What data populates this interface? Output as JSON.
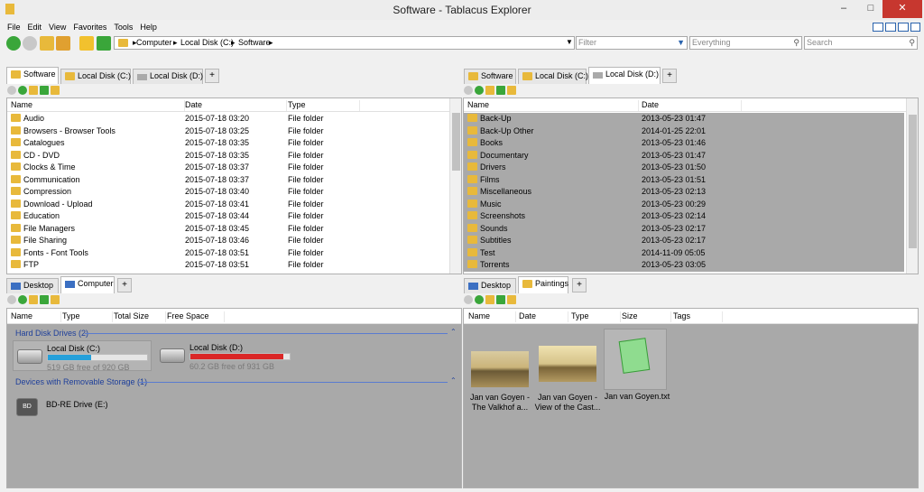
{
  "window": {
    "title": "Software - Tablacus Explorer",
    "min": "–",
    "max": "□",
    "close": "✕"
  },
  "menu": [
    "File",
    "Edit",
    "View",
    "Favorites",
    "Tools",
    "Help"
  ],
  "address": {
    "parts": [
      "Computer",
      "Local Disk (C:)",
      "Software"
    ]
  },
  "filter_placeholder": "Filter",
  "everything_placeholder": "Everything",
  "search_placeholder": "Search",
  "top_left": {
    "tabs": [
      "Software",
      "Local Disk (C:)",
      "Local Disk (D:)"
    ],
    "columns": [
      "Name",
      "Date",
      "Type"
    ],
    "rows": [
      [
        "Audio",
        "2015-07-18 03:20",
        "File folder"
      ],
      [
        "Browsers - Browser Tools",
        "2015-07-18 03:25",
        "File folder"
      ],
      [
        "Catalogues",
        "2015-07-18 03:35",
        "File folder"
      ],
      [
        "CD - DVD",
        "2015-07-18 03:35",
        "File folder"
      ],
      [
        "Clocks & Time",
        "2015-07-18 03:37",
        "File folder"
      ],
      [
        "Communication",
        "2015-07-18 03:37",
        "File folder"
      ],
      [
        "Compression",
        "2015-07-18 03:40",
        "File folder"
      ],
      [
        "Download - Upload",
        "2015-07-18 03:41",
        "File folder"
      ],
      [
        "Education",
        "2015-07-18 03:44",
        "File folder"
      ],
      [
        "File Managers",
        "2015-07-18 03:45",
        "File folder"
      ],
      [
        "File Sharing",
        "2015-07-18 03:46",
        "File folder"
      ],
      [
        "Fonts - Font Tools",
        "2015-07-18 03:51",
        "File folder"
      ],
      [
        "FTP",
        "2015-07-18 03:51",
        "File folder"
      ]
    ]
  },
  "top_right": {
    "tabs": [
      "Software",
      "Local Disk (C:)",
      "Local Disk (D:)"
    ],
    "columns": [
      "Name",
      "Date"
    ],
    "rows": [
      [
        "Back-Up",
        "2013-05-23 01:47"
      ],
      [
        "Back-Up Other",
        "2014-01-25 22:01"
      ],
      [
        "Books",
        "2013-05-23 01:46"
      ],
      [
        "Documentary",
        "2013-05-23 01:47"
      ],
      [
        "Drivers",
        "2013-05-23 01:50"
      ],
      [
        "Films",
        "2013-05-23 01:51"
      ],
      [
        "Miscellaneous",
        "2013-05-23 02:13"
      ],
      [
        "Music",
        "2013-05-23 00:29"
      ],
      [
        "Screenshots",
        "2013-05-23 02:14"
      ],
      [
        "Sounds",
        "2013-05-23 02:17"
      ],
      [
        "Subtitles",
        "2013-05-23 02:17"
      ],
      [
        "Test",
        "2014-11-09 05:05"
      ],
      [
        "Torrents",
        "2013-05-23 03:05"
      ]
    ]
  },
  "bottom_left": {
    "tabs": [
      "Desktop",
      "Computer"
    ],
    "columns": [
      "Name",
      "Type",
      "Total Size",
      "Free Space"
    ],
    "group1": "Hard Disk Drives (2)",
    "drives": [
      {
        "label": "Local Disk (C:)",
        "free": "519 GB free of 920 GB",
        "used": 0.44,
        "color": "#26a0da"
      },
      {
        "label": "Local Disk (D:)",
        "free": "60.2 GB free of 931 GB",
        "used": 0.94,
        "color": "#da2626"
      }
    ],
    "group2": "Devices with Removable Storage (1)",
    "removable": {
      "label": "BD-RE Drive (E:)",
      "icon_text": "BD"
    }
  },
  "bottom_right": {
    "tabs": [
      "Desktop",
      "Paintings"
    ],
    "columns": [
      "Name",
      "Date",
      "Type",
      "Size",
      "Tags"
    ],
    "items": [
      {
        "l1": "Jan van Goyen -",
        "l2": "The Valkhof a..."
      },
      {
        "l1": "Jan van Goyen -",
        "l2": "View of the Cast..."
      },
      {
        "l1": "Jan van Goyen.txt",
        "l2": ""
      }
    ]
  }
}
